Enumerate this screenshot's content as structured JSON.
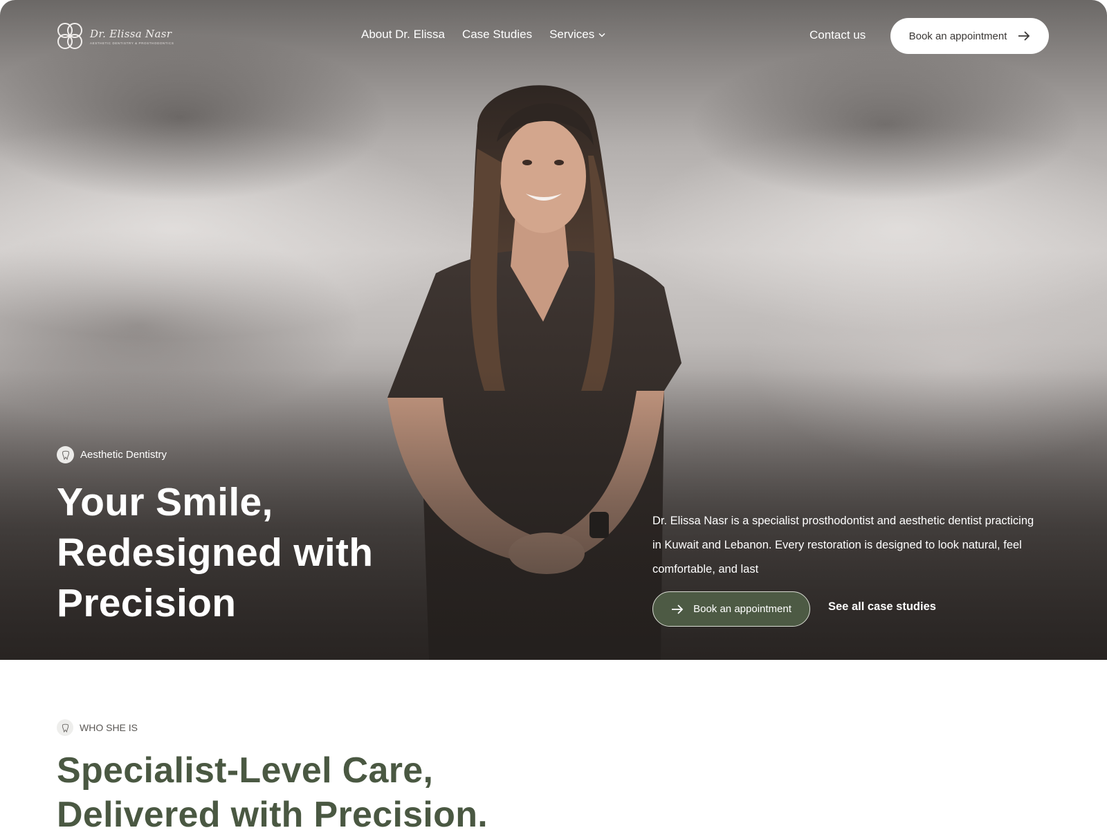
{
  "header": {
    "logo_text": "Dr. Elissa Nasr",
    "logo_tagline": "AESTHETIC DENTISTRY & PROSTHODONTICS",
    "nav": [
      {
        "label": "About Dr. Elissa"
      },
      {
        "label": "Case Studies"
      },
      {
        "label": "Services",
        "icon": "chevron-down-icon"
      }
    ],
    "contact_label": "Contact us",
    "book_label": "Book an appointment"
  },
  "hero": {
    "tag": "Aesthetic Dentistry",
    "title_lines": [
      "Your Smile,",
      "Redesigned with",
      "Precision"
    ],
    "description": "Dr. Elissa Nasr is a specialist prosthodontist and aesthetic dentist practicing in Kuwait and Lebanon. Every restoration is designed to look natural, feel comfortable, and last",
    "book_label": "Book an appointment",
    "secondary_label": "See all case studies"
  },
  "about": {
    "eyebrow": "WHO SHE IS",
    "title_lines": [
      "Specialist-Level Care,",
      "Delivered with Precision."
    ]
  },
  "colors": {
    "accent_green": "#4d5a44",
    "heading_green": "#4a5842",
    "hero_text": "#ffffff"
  }
}
